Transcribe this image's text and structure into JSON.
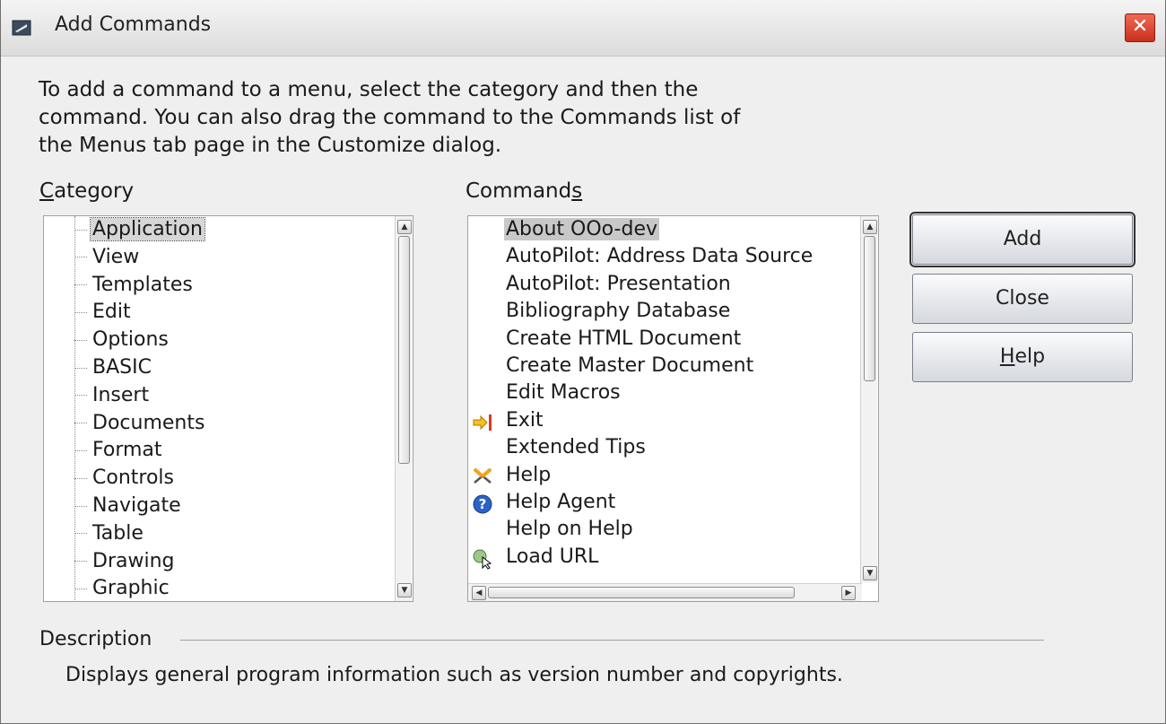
{
  "window": {
    "title": "Add Commands",
    "close_glyph": "✕"
  },
  "intro": "To add a command to a menu, select the category and then the\ncommand. You can also drag the command to the Commands list of\nthe Menus tab page in the Customize dialog.",
  "category": {
    "label_mnemonic": "C",
    "label_rest": "ategory",
    "items": [
      "Application",
      "View",
      "Templates",
      "Edit",
      "Options",
      "BASIC",
      "Insert",
      "Documents",
      "Format",
      "Controls",
      "Navigate",
      "Table",
      "Drawing",
      "Graphic"
    ],
    "selected": "Application"
  },
  "commands": {
    "label_start": "Command",
    "label_mnemonic": "s",
    "items": [
      {
        "label": "About OOo-dev",
        "icon": ""
      },
      {
        "label": "AutoPilot: Address Data Source",
        "icon": ""
      },
      {
        "label": "AutoPilot: Presentation",
        "icon": ""
      },
      {
        "label": "Bibliography Database",
        "icon": ""
      },
      {
        "label": "Create HTML Document",
        "icon": ""
      },
      {
        "label": "Create Master Document",
        "icon": ""
      },
      {
        "label": "Edit Macros",
        "icon": ""
      },
      {
        "label": "Exit",
        "icon": "exit-arrow-icon"
      },
      {
        "label": "Extended Tips",
        "icon": ""
      },
      {
        "label": "Help",
        "icon": "scissors-icon"
      },
      {
        "label": "Help Agent",
        "icon": "help-question-icon"
      },
      {
        "label": "Help on Help",
        "icon": ""
      },
      {
        "label": "Load URL",
        "icon": "load-url-icon"
      }
    ],
    "selected": "About OOo-dev"
  },
  "buttons": {
    "add": "Add",
    "close": "Close",
    "help_mnemonic": "H",
    "help_rest": "elp"
  },
  "description": {
    "label": "Description",
    "text": "Displays general program information such as version number and copyrights."
  },
  "scroll_glyphs": {
    "up": "▲",
    "down": "▼",
    "left": "◀",
    "right": "▶"
  }
}
